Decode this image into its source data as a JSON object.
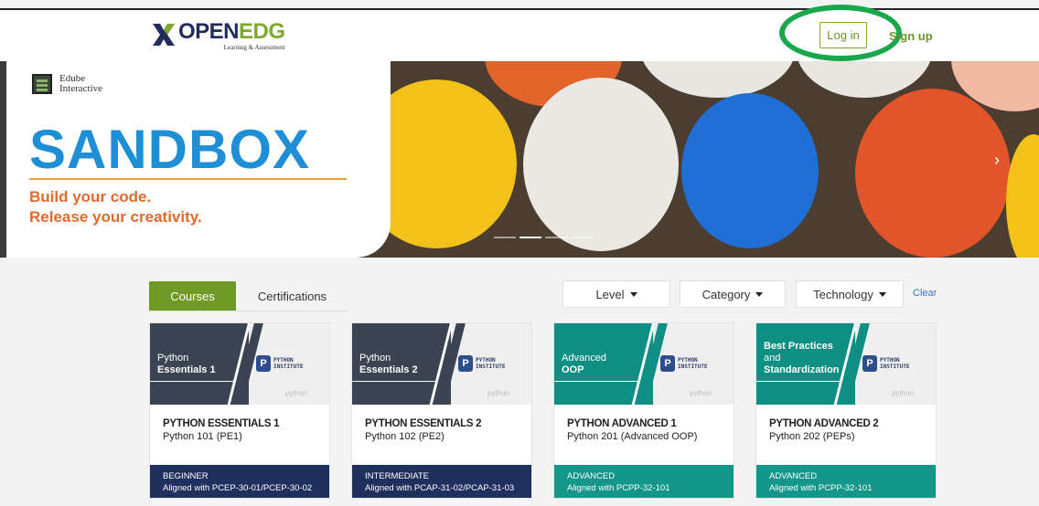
{
  "header": {
    "brand_open": "OPEN",
    "brand_edg": "EDG",
    "brand_sub": "Learning & Assessment",
    "login_label": "Log in",
    "signup_label": "Sign up"
  },
  "hero": {
    "edube_line1": "Edube",
    "edube_line2": "Interactive",
    "title": "SANDBOX",
    "tagline1": "Build your code.",
    "tagline2": "Release your creativity.",
    "next_arrow": "›"
  },
  "tabs": [
    {
      "label": "Courses",
      "active": true
    },
    {
      "label": "Certifications",
      "active": false
    }
  ],
  "filters": {
    "level": "Level",
    "category": "Category",
    "technology": "Technology",
    "clear": "Clear"
  },
  "logo_text": {
    "pi_line1": "PYTHON",
    "pi_line2": "INSTITUTE",
    "python": "python"
  },
  "courses": [
    {
      "thumb_line1": "Python",
      "thumb_line2": "Essentials 1",
      "title": "PYTHON ESSENTIALS 1",
      "subtitle": "Python 101 (PE1)",
      "level": "BEGINNER",
      "aligned": "Aligned with PCEP-30-01/PCEP-30-02",
      "band_color": "#3b4453",
      "foot_color": "#1f2f5e"
    },
    {
      "thumb_line1": "Python",
      "thumb_line2": "Essentials 2",
      "title": "PYTHON ESSENTIALS 2",
      "subtitle": "Python 102 (PE2)",
      "level": "INTERMEDIATE",
      "aligned": "Aligned with PCAP-31-02/PCAP-31-03",
      "band_color": "#3b4453",
      "foot_color": "#1f2f5e"
    },
    {
      "thumb_line1": "Advanced",
      "thumb_line2": "OOP",
      "title": "PYTHON ADVANCED 1",
      "subtitle": "Python 201 (Advanced OOP)",
      "level": "ADVANCED",
      "aligned": "Aligned with PCPP-32-101",
      "band_color": "#0f8f84",
      "foot_color": "#14968a"
    },
    {
      "thumb_line0": "Best Practices",
      "thumb_line1": "and",
      "thumb_line2": "Standardization",
      "title": "PYTHON ADVANCED 2",
      "subtitle": "Python 202 (PEPs)",
      "level": "ADVANCED",
      "aligned": "Aligned with PCPP-32-101",
      "band_color": "#0f8f84",
      "foot_color": "#14968a"
    }
  ],
  "colors": {
    "brand_green": "#6f9a26",
    "highlight_ring": "#1aa64a",
    "sandbox_blue": "#1e8fd6",
    "tagline_orange": "#e06a2c"
  }
}
